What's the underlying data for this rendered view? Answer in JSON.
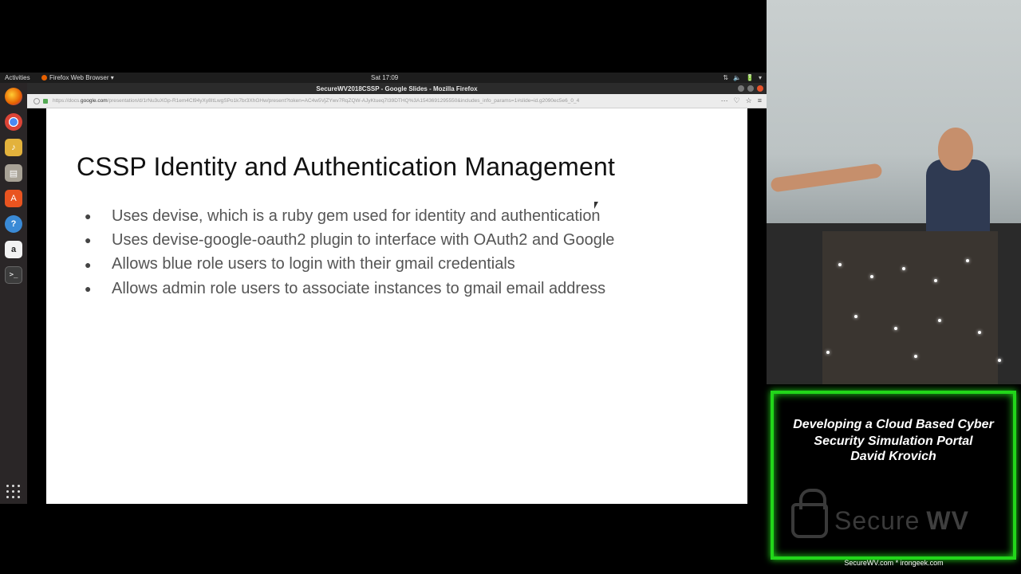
{
  "top_panel": {
    "activities": "Activities",
    "app_menu": "Firefox Web Browser ▾",
    "clock": "Sat 17:09",
    "tray": [
      "⇅",
      "🔈",
      "🔋",
      "▾"
    ]
  },
  "browser": {
    "window_title": "SecureWV2018CSSP - Google Slides - Mozilla Firefox",
    "url_prefix": "https://docs.",
    "url_domain": "google.com",
    "url_rest": "/presentation/d/1rNu3uXGp-R1em4Cl94yXy8ItLwgSPo1k7br3XhGHw/present?token=AC4w5VjZYwv7RqZQW-AJyKtueq7I39DTHQ%3A1543691295550&includes_info_params=1#slide=id.g2090ec5e6_0_4",
    "tools": [
      "···",
      "♡",
      "☆",
      "≡"
    ]
  },
  "slide": {
    "title": "CSSP Identity and Authentication Management",
    "bullets": [
      "Uses devise, which is a ruby gem used for identity and authentication",
      "Uses devise-google-oauth2 plugin to interface with OAuth2 and Google",
      "Allows blue role users to login with their gmail credentials",
      "Allows admin role users to associate instances to gmail email address"
    ]
  },
  "talk": {
    "title": "Developing a Cloud Based Cyber\nSecurity Simulation Portal",
    "speaker": "David Krovich",
    "brand_left": "Secure",
    "brand_right": "WV",
    "footer": "SecureWV.com * irongeek.com"
  },
  "colors": {
    "panel_border": "#22d61a",
    "dock_bg": "#2a2627",
    "slide_bg": "#ffffff"
  }
}
